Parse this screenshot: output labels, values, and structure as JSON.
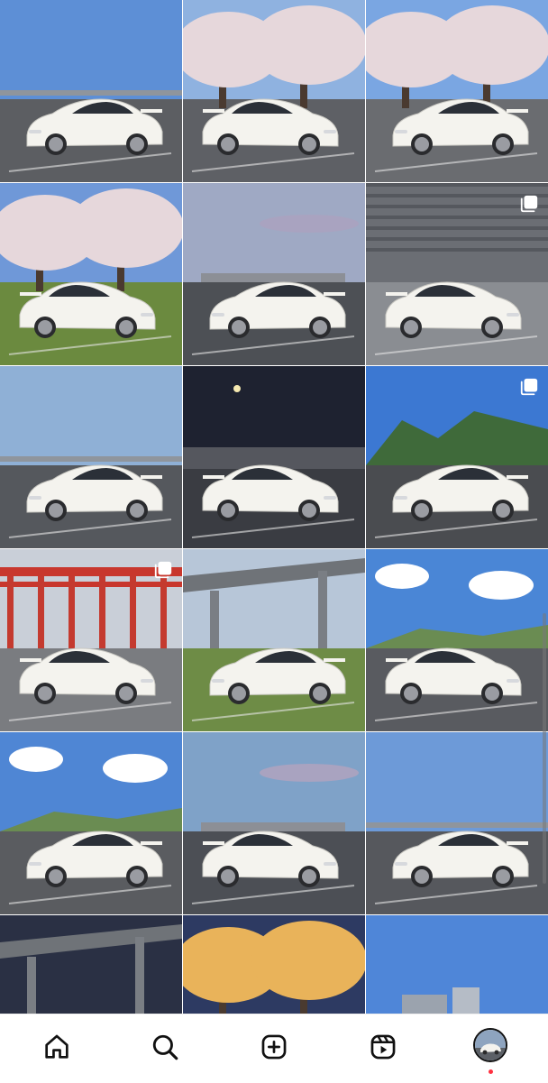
{
  "feed": {
    "posts": [
      {
        "sky": "#5d8fd6",
        "ground": "#5c5e62",
        "scene": "lot",
        "multi": false
      },
      {
        "sky": "#8fb2e0",
        "ground": "#5e6065",
        "scene": "sakura",
        "multi": false
      },
      {
        "sky": "#7aa6e2",
        "ground": "#6a6c70",
        "scene": "sakura",
        "multi": false
      },
      {
        "sky": "#6f98d8",
        "ground": "#6b8a3f",
        "scene": "sakura",
        "multi": false
      },
      {
        "sky": "#9fa9c4",
        "ground": "#4d5055",
        "scene": "dusk",
        "multi": false
      },
      {
        "sky": "#6b6e74",
        "ground": "#8a8d92",
        "scene": "garage",
        "multi": true
      },
      {
        "sky": "#8fb0d6",
        "ground": "#55585d",
        "scene": "lot",
        "multi": false
      },
      {
        "sky": "#1e2230",
        "ground": "#3a3c42",
        "scene": "night",
        "multi": false
      },
      {
        "sky": "#3c78d2",
        "ground": "#4a4c50",
        "scene": "mountain",
        "multi": true
      },
      {
        "sky": "#c9cfd8",
        "ground": "#7a7c80",
        "scene": "torii",
        "multi": true
      },
      {
        "sky": "#b7c6d8",
        "ground": "#6e8c46",
        "scene": "bridge",
        "multi": false
      },
      {
        "sky": "#4a86d6",
        "ground": "#595b60",
        "scene": "clouds",
        "multi": false
      },
      {
        "sky": "#4f86d4",
        "ground": "#5a5c60",
        "scene": "clouds",
        "multi": false
      },
      {
        "sky": "#7fa2c8",
        "ground": "#4c4f55",
        "scene": "dusk",
        "multi": false
      },
      {
        "sky": "#6d9ad8",
        "ground": "#56585d",
        "scene": "lot",
        "multi": false
      },
      {
        "sky": "#2a3044",
        "ground": "#3b3e46",
        "scene": "highway",
        "multi": false
      },
      {
        "sky": "#2d3a62",
        "ground": "#d99a3a",
        "scene": "trees",
        "multi": false
      },
      {
        "sky": "#4f86d8",
        "ground": "#8da6c8",
        "scene": "harbor",
        "multi": false
      }
    ],
    "car_color": "#f4f3ee",
    "multi_icon": "multiple-photos-icon"
  },
  "nav": {
    "items": [
      {
        "icon": "home-icon",
        "active": true
      },
      {
        "icon": "search-icon",
        "active": false
      },
      {
        "icon": "create-post-icon",
        "active": false
      },
      {
        "icon": "reels-icon",
        "active": false
      },
      {
        "icon": "profile-avatar",
        "active": false
      }
    ],
    "notification_color": "#ff3040"
  }
}
